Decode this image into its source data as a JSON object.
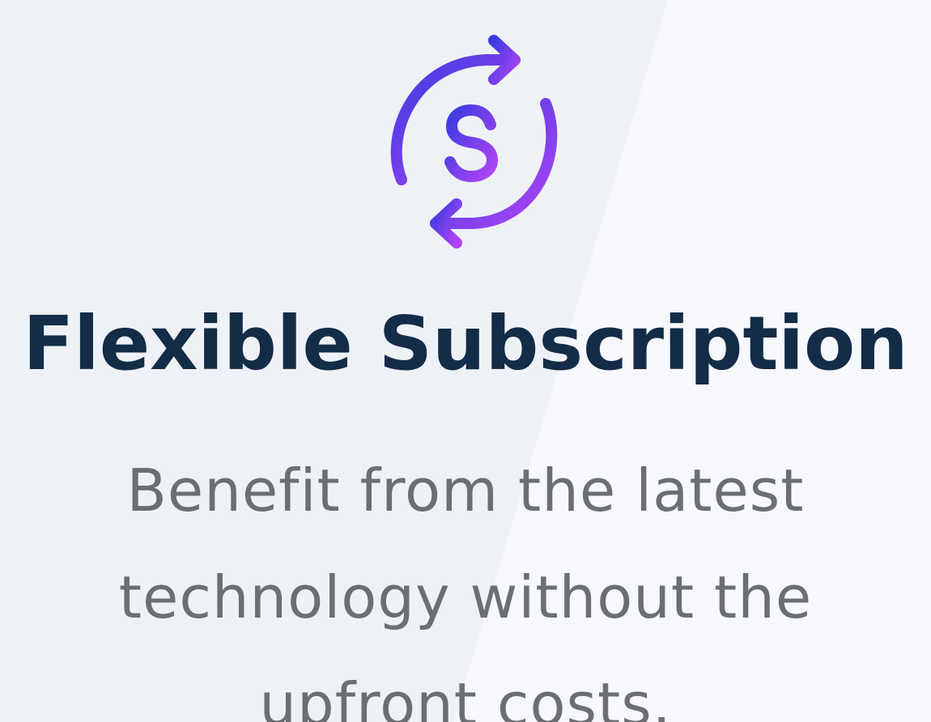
{
  "feature": {
    "icon": "recurring-dollar-icon",
    "title": "Flexible Subscription",
    "description": "Benefit from the latest technology without the upfront costs."
  },
  "colors": {
    "background": "#eef2f7",
    "background_highlight": "#f6f8fc",
    "title": "#132c47",
    "description": "#6b6f73",
    "icon_gradient_start": "#3b3be0",
    "icon_gradient_end": "#b044f5"
  }
}
